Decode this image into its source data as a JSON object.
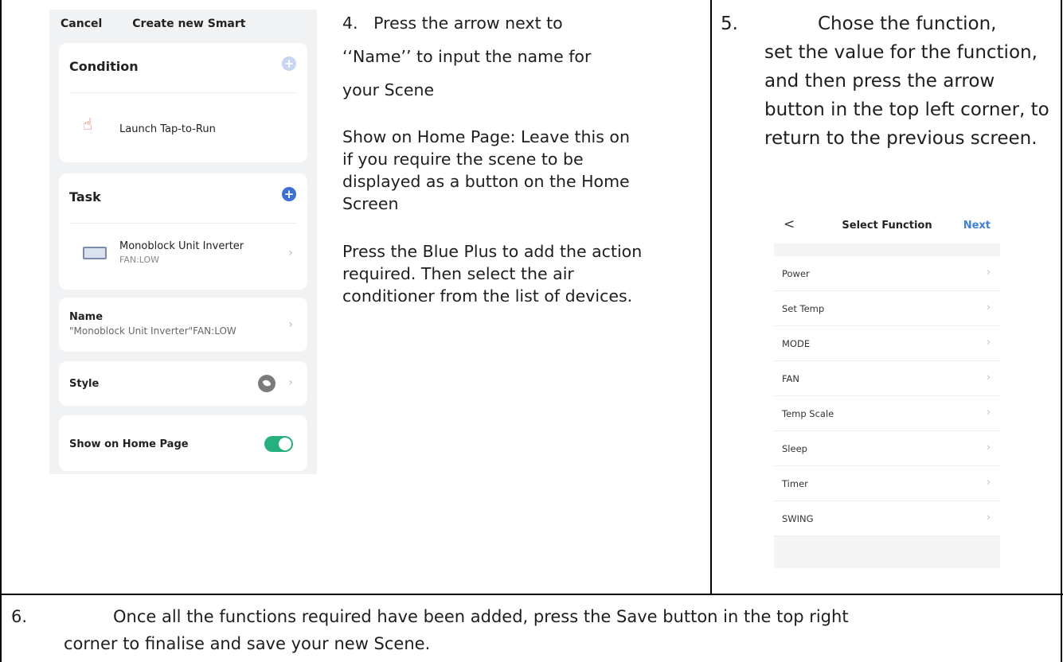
{
  "screen1": {
    "cancel": "Cancel",
    "title": "Create new Smart",
    "condition": {
      "header": "Condition",
      "item": "Launch Tap-to-Run"
    },
    "task": {
      "header": "Task",
      "device_name": "Monoblock Unit Inverter",
      "device_setting": "FAN:LOW"
    },
    "name_row": {
      "label": "Name",
      "value": "\"Monoblock Unit Inverter\"FAN:LOW"
    },
    "style_label": "Style",
    "show_home_label": "Show on Home Page",
    "show_home_on": true
  },
  "step4": {
    "num": "4.",
    "line1": "Press the arrow next to",
    "line2": "‘‘Name’’ to input the name for",
    "line3": "your Scene",
    "show_para": "Show on Home Page: Leave this on if you require the scene to be displayed as a button on the Home Screen",
    "plus_para": "Press the Blue Plus to add the action required. Then select the air conditioner from the list of devices."
  },
  "step5": {
    "num": "5.",
    "first": "Chose the function,",
    "rest": "set the value for the function, and then press the arrow button in the top left corner, to return to the previous screen."
  },
  "screen2": {
    "back": "<",
    "title": "Select Function",
    "next": "Next",
    "items": [
      "Power",
      "Set Temp",
      "MODE",
      "FAN",
      "Temp Scale",
      "Sleep",
      "Timer",
      "SWING"
    ]
  },
  "step6": {
    "num": "6.",
    "line1": "Once all the functions required have been added, press the Save button in the top right",
    "line2": "corner to finalise and save your new Scene."
  },
  "colors": {
    "accent_blue": "#3f7fde",
    "plus_blue": "#3b6fd6",
    "plus_light": "#c9d6f1",
    "toggle_green": "#26b07c"
  }
}
